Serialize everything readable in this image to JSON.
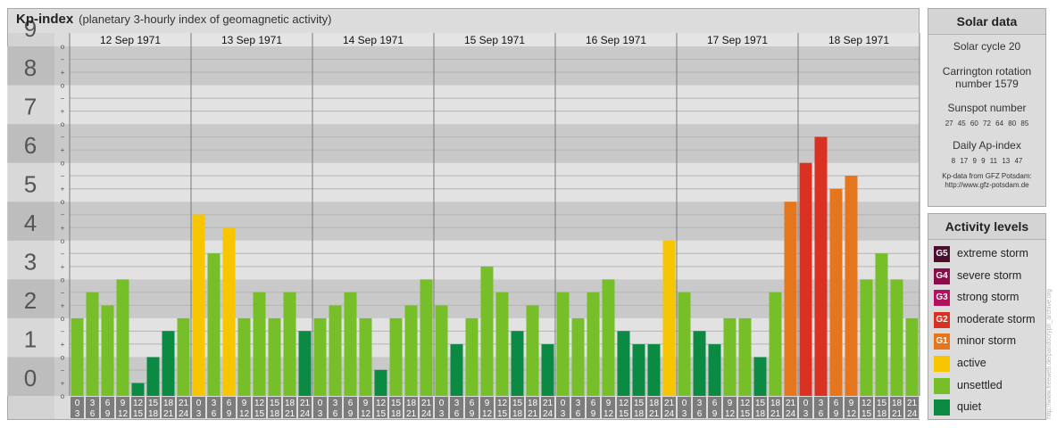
{
  "header": {
    "title": "Kp-index",
    "subtitle": "(planetary 3-hourly index of geomagnetic activity)"
  },
  "chart_data": {
    "type": "bar",
    "title": "Kp-index",
    "subtitle": "(planetary 3-hourly index of geomagnetic activity)",
    "ylim": [
      0,
      9
    ],
    "y_ticks": [
      "0",
      "1",
      "2",
      "3",
      "4",
      "5",
      "6",
      "7",
      "8",
      "9"
    ],
    "minor_marks": [
      "+",
      "o",
      "−"
    ],
    "days": [
      "12 Sep 1971",
      "13 Sep 1971",
      "14 Sep 1971",
      "15 Sep 1971",
      "16 Sep 1971",
      "17 Sep 1971",
      "18 Sep 1971"
    ],
    "interval_labels": [
      [
        "0",
        "3"
      ],
      [
        "3",
        "6"
      ],
      [
        "6",
        "9"
      ],
      [
        "9",
        "12"
      ],
      [
        "12",
        "15"
      ],
      [
        "15",
        "18"
      ],
      [
        "18",
        "21"
      ],
      [
        "21",
        "24"
      ]
    ],
    "values": [
      [
        2.0,
        2.67,
        2.33,
        3.0,
        0.33,
        1.0,
        1.67,
        2.0
      ],
      [
        4.67,
        3.67,
        4.33,
        2.0,
        2.67,
        2.0,
        2.67,
        1.67
      ],
      [
        2.0,
        2.33,
        2.67,
        2.0,
        0.67,
        2.0,
        2.33,
        3.0
      ],
      [
        2.33,
        1.33,
        2.0,
        3.33,
        2.67,
        1.67,
        2.33,
        1.33
      ],
      [
        2.67,
        2.0,
        2.67,
        3.0,
        1.67,
        1.33,
        1.33,
        4.0
      ],
      [
        2.67,
        1.67,
        1.33,
        2.0,
        2.0,
        1.0,
        2.67,
        5.0
      ],
      [
        6.0,
        6.67,
        5.33,
        5.67,
        3.0,
        3.67,
        3.0,
        2.0
      ]
    ]
  },
  "solar": {
    "title": "Solar data",
    "cycle": "Solar cycle 20",
    "carrington_line1": "Carrington rotation",
    "carrington_line2": "number 1579",
    "sunspot_title": "Sunspot number",
    "sunspot_values": "27 45 60 72 64 80 85",
    "ap_title": "Daily Ap-index",
    "ap_values": "8 17 9 9 11 13 47",
    "credit_line1": "Kp-data from GFZ Potsdam:",
    "credit_line2": "http://www.gfz-potsdam.de"
  },
  "levels": {
    "title": "Activity levels",
    "items": [
      {
        "code": "G5",
        "label": "extreme storm",
        "color": "#4a0f2e"
      },
      {
        "code": "G4",
        "label": "severe storm",
        "color": "#8a0c4a"
      },
      {
        "code": "G3",
        "label": "strong storm",
        "color": "#b3105e"
      },
      {
        "code": "G2",
        "label": "moderate storm",
        "color": "#d93223"
      },
      {
        "code": "G1",
        "label": "minor storm",
        "color": "#e6761e"
      },
      {
        "code": "",
        "label": "active",
        "color": "#f8c600"
      },
      {
        "code": "",
        "label": "unsettled",
        "color": "#76bf29"
      },
      {
        "code": "",
        "label": "quiet",
        "color": "#0a8a42"
      }
    ]
  },
  "watermark": "http://www.freeweb.de/pandocryph_archive.org"
}
